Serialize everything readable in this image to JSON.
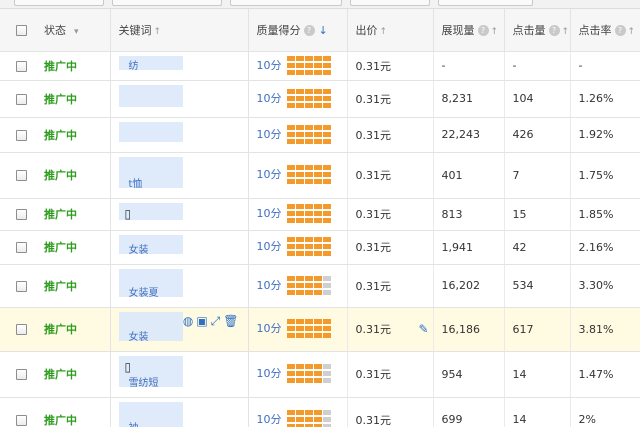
{
  "columns": {
    "status": "状态",
    "keyword": "关键词",
    "quality": "质量得分",
    "bid": "出价",
    "impressions": "展现量",
    "clicks": "点击量",
    "ctr": "点击率"
  },
  "icons": {
    "sort_up": "↑",
    "sort_down": "↓",
    "help": "?",
    "filter": "▾",
    "phone": "▯",
    "edit": "✎",
    "actions": "◍▣⤢🗑"
  },
  "colors": {
    "status_active": "#2e9c1f",
    "link": "#3f6fbf",
    "bar_on": "#f39a2b",
    "bar_off": "#cfcfcf",
    "highlight_row": "#fffbe3"
  },
  "rows": [
    {
      "status": "推广中",
      "keyword": "纺",
      "phone": false,
      "quality": "10分",
      "quality_level": 10,
      "bid": "0.31元",
      "impressions": "-",
      "clicks": "-",
      "ctr": "-"
    },
    {
      "status": "推广中",
      "keyword": "",
      "phone": false,
      "quality": "10分",
      "quality_level": 9,
      "bid": "0.31元",
      "impressions": "8,231",
      "clicks": "104",
      "ctr": "1.26%"
    },
    {
      "status": "推广中",
      "keyword": "",
      "phone": false,
      "quality": "10分",
      "quality_level": 9,
      "bid": "0.31元",
      "impressions": "22,243",
      "clicks": "426",
      "ctr": "1.92%"
    },
    {
      "status": "推广中",
      "keyword": "t恤",
      "phone": false,
      "quality": "10分",
      "quality_level": 10,
      "bid": "0.31元",
      "impressions": "401",
      "clicks": "7",
      "ctr": "1.75%"
    },
    {
      "status": "推广中",
      "keyword": "",
      "phone": true,
      "quality": "10分",
      "quality_level": 9,
      "bid": "0.31元",
      "impressions": "813",
      "clicks": "15",
      "ctr": "1.85%"
    },
    {
      "status": "推广中",
      "keyword": "女装",
      "phone": false,
      "quality": "10分",
      "quality_level": 9,
      "bid": "0.31元",
      "impressions": "1,941",
      "clicks": "42",
      "ctr": "2.16%"
    },
    {
      "status": "推广中",
      "keyword": "女装夏",
      "phone": false,
      "quality": "10分",
      "quality_level": 8,
      "bid": "0.31元",
      "impressions": "16,202",
      "clicks": "534",
      "ctr": "3.30%"
    },
    {
      "status": "推广中",
      "keyword": "女装",
      "phone": false,
      "quality": "10分",
      "quality_level": 9,
      "bid": "0.31元",
      "impressions": "16,186",
      "clicks": "617",
      "ctr": "3.81%",
      "highlight": true
    },
    {
      "status": "推广中",
      "keyword": "雪纺短",
      "phone": true,
      "quality": "10分",
      "quality_level": 8,
      "bid": "0.31元",
      "impressions": "954",
      "clicks": "14",
      "ctr": "1.47%"
    },
    {
      "status": "推广中",
      "keyword": "袖",
      "phone": false,
      "quality": "10分",
      "quality_level": 8,
      "bid": "0.31元",
      "impressions": "699",
      "clicks": "14",
      "ctr": "2%"
    }
  ]
}
